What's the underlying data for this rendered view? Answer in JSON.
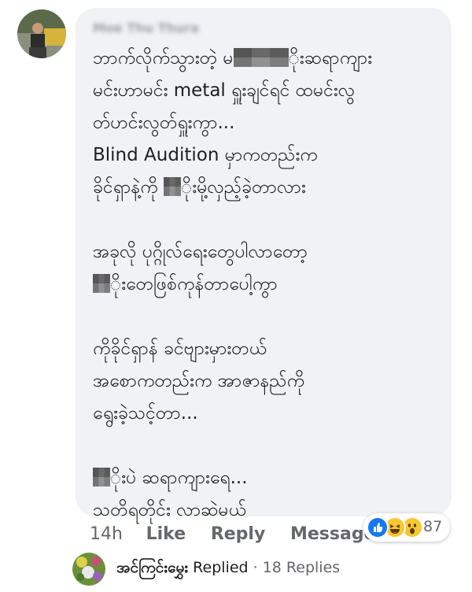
{
  "comment": {
    "author_name": "Moe Thu Thura",
    "lines": [
      {
        "parts": [
          {
            "t": "ဘာက်လိုက်သွားတဲ့ မ"
          },
          {
            "m": "wide"
          },
          {
            "t": "ိုးဆရာကျား"
          }
        ]
      },
      {
        "parts": [
          {
            "t": "မင်းဟာမင်း metal ရှူးချင်ရင် ထမင်းလွ"
          }
        ]
      },
      {
        "parts": [
          {
            "t": "တ်ဟင်းလွတ်ရှူးကွာ..."
          }
        ]
      },
      {
        "parts": [
          {
            "t": "Blind Audition မှာကတည်းက"
          }
        ]
      },
      {
        "parts": [
          {
            "t": "ခိုင်ရှာနဲ့ကို "
          },
          {
            "m": "narrow"
          },
          {
            "t": "ိုးမို့လှည့်ခဲ့တာလား"
          }
        ]
      },
      {
        "gap": true
      },
      {
        "parts": [
          {
            "t": "အခုလို ပုဂ္ဂိုလ်ရေးတွေပါလာတော့"
          }
        ]
      },
      {
        "parts": [
          {
            "m": "narrow"
          },
          {
            "t": "ိုးတေဖြစ်ကုန်တာပေါ့ကွာ"
          }
        ]
      },
      {
        "gap": true
      },
      {
        "parts": [
          {
            "t": "ကိုခိုင်ရှာန် ခင်ဗျားမှားတယ်"
          }
        ]
      },
      {
        "parts": [
          {
            "t": "အစောကတည်းက အာဇာနည်ကို"
          }
        ]
      },
      {
        "parts": [
          {
            "t": "ရွေးခဲ့သင့်တာ..."
          }
        ]
      },
      {
        "gap": true
      },
      {
        "parts": [
          {
            "m": "narrow"
          },
          {
            "t": "ိုးပဲ ဆရာကျားရေ..."
          }
        ]
      },
      {
        "parts": [
          {
            "t": "သတိရတိုင်း လာဆဲမယ်"
          }
        ]
      }
    ]
  },
  "actions": {
    "time": "14h",
    "like": "Like",
    "reply": "Reply",
    "message": "Message"
  },
  "reactions": {
    "icons": [
      "like-icon",
      "haha-icon",
      "wow-icon"
    ],
    "colors": {
      "like": "#1877f2",
      "haha": "#f7c631",
      "wow": "#f7c631"
    },
    "count": "87"
  },
  "replies": {
    "replier_name": "အင်ကြင်းမွှေး",
    "replied_label": "Replied",
    "separator": "·",
    "count_label": "18 Replies"
  }
}
